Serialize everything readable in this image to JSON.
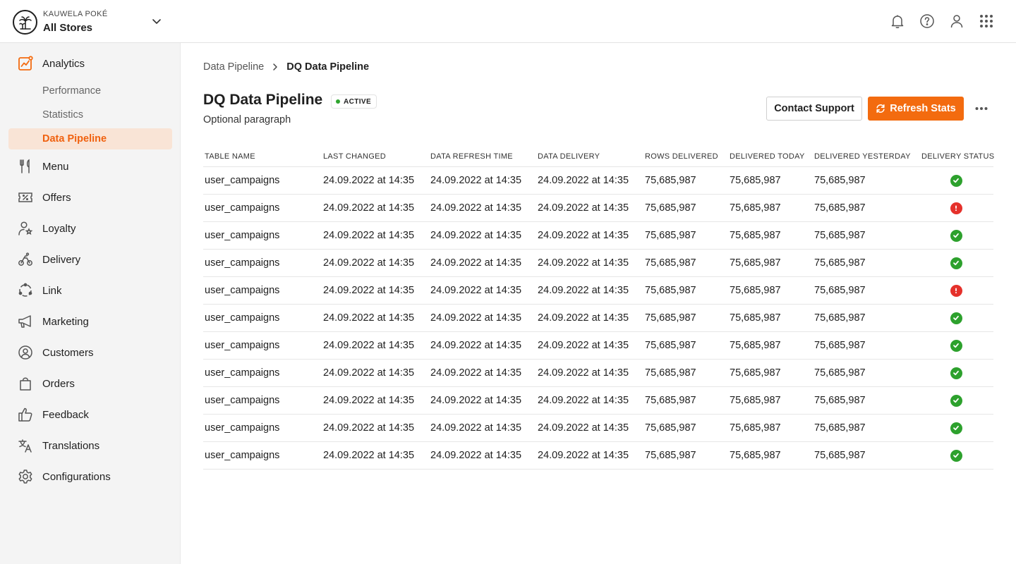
{
  "brand": {
    "company": "KAUWELA POKÉ",
    "store": "All Stores",
    "logo_icon": "palm-tree-icon"
  },
  "topbar": {
    "icons": [
      "bell-icon",
      "help-icon",
      "user-icon",
      "apps-grid-icon"
    ]
  },
  "sidebar": {
    "analytics": {
      "label": "Analytics",
      "sub_items": [
        {
          "label": "Performance"
        },
        {
          "label": "Statistics"
        },
        {
          "label": "Data Pipeline",
          "active": true
        }
      ]
    },
    "items": [
      {
        "label": "Menu",
        "icon": "fork-knife-icon"
      },
      {
        "label": "Offers",
        "icon": "ticket-icon"
      },
      {
        "label": "Loyalty",
        "icon": "user-star-icon"
      },
      {
        "label": "Delivery",
        "icon": "scooter-icon"
      },
      {
        "label": "Link",
        "icon": "link-circle-icon"
      },
      {
        "label": "Marketing",
        "icon": "megaphone-icon"
      },
      {
        "label": "Customers",
        "icon": "customers-icon"
      },
      {
        "label": "Orders",
        "icon": "shopping-bag-icon"
      },
      {
        "label": "Feedback",
        "icon": "thumbs-up-icon"
      },
      {
        "label": "Translations",
        "icon": "translate-icon"
      },
      {
        "label": "Configurations",
        "icon": "gear-icon"
      }
    ]
  },
  "breadcrumb": {
    "parent": "Data Pipeline",
    "current": "DQ Data Pipeline"
  },
  "page": {
    "title": "DQ Data Pipeline",
    "status": "ACTIVE",
    "subtitle": "Optional paragraph"
  },
  "actions": {
    "contact_support": "Contact Support",
    "refresh_stats": "Refresh Stats"
  },
  "colors": {
    "accent": "#f36b0f",
    "ok": "#2da12d",
    "error": "#e5312b"
  },
  "table": {
    "columns": [
      "TABLE NAME",
      "LAST CHANGED",
      "DATA REFRESH TIME",
      "DATA DELIVERY",
      "ROWS DELIVERED",
      "DELIVERED TODAY",
      "DELIVERED YESTERDAY",
      "DELIVERY STATUS"
    ],
    "rows": [
      {
        "table_name": "user_campaigns",
        "last_changed": "24.09.2022 at 14:35",
        "refresh_time": "24.09.2022 at 14:35",
        "delivery": "24.09.2022 at 14:35",
        "rows_delivered": "75,685,987",
        "today": "75,685,987",
        "yesterday": "75,685,987",
        "status": "ok"
      },
      {
        "table_name": "user_campaigns",
        "last_changed": "24.09.2022 at 14:35",
        "refresh_time": "24.09.2022 at 14:35",
        "delivery": "24.09.2022 at 14:35",
        "rows_delivered": "75,685,987",
        "today": "75,685,987",
        "yesterday": "75,685,987",
        "status": "error"
      },
      {
        "table_name": "user_campaigns",
        "last_changed": "24.09.2022 at 14:35",
        "refresh_time": "24.09.2022 at 14:35",
        "delivery": "24.09.2022 at 14:35",
        "rows_delivered": "75,685,987",
        "today": "75,685,987",
        "yesterday": "75,685,987",
        "status": "ok"
      },
      {
        "table_name": "user_campaigns",
        "last_changed": "24.09.2022 at 14:35",
        "refresh_time": "24.09.2022 at 14:35",
        "delivery": "24.09.2022 at 14:35",
        "rows_delivered": "75,685,987",
        "today": "75,685,987",
        "yesterday": "75,685,987",
        "status": "ok"
      },
      {
        "table_name": "user_campaigns",
        "last_changed": "24.09.2022 at 14:35",
        "refresh_time": "24.09.2022 at 14:35",
        "delivery": "24.09.2022 at 14:35",
        "rows_delivered": "75,685,987",
        "today": "75,685,987",
        "yesterday": "75,685,987",
        "status": "error"
      },
      {
        "table_name": "user_campaigns",
        "last_changed": "24.09.2022 at 14:35",
        "refresh_time": "24.09.2022 at 14:35",
        "delivery": "24.09.2022 at 14:35",
        "rows_delivered": "75,685,987",
        "today": "75,685,987",
        "yesterday": "75,685,987",
        "status": "ok"
      },
      {
        "table_name": "user_campaigns",
        "last_changed": "24.09.2022 at 14:35",
        "refresh_time": "24.09.2022 at 14:35",
        "delivery": "24.09.2022 at 14:35",
        "rows_delivered": "75,685,987",
        "today": "75,685,987",
        "yesterday": "75,685,987",
        "status": "ok"
      },
      {
        "table_name": "user_campaigns",
        "last_changed": "24.09.2022 at 14:35",
        "refresh_time": "24.09.2022 at 14:35",
        "delivery": "24.09.2022 at 14:35",
        "rows_delivered": "75,685,987",
        "today": "75,685,987",
        "yesterday": "75,685,987",
        "status": "ok"
      },
      {
        "table_name": "user_campaigns",
        "last_changed": "24.09.2022 at 14:35",
        "refresh_time": "24.09.2022 at 14:35",
        "delivery": "24.09.2022 at 14:35",
        "rows_delivered": "75,685,987",
        "today": "75,685,987",
        "yesterday": "75,685,987",
        "status": "ok"
      },
      {
        "table_name": "user_campaigns",
        "last_changed": "24.09.2022 at 14:35",
        "refresh_time": "24.09.2022 at 14:35",
        "delivery": "24.09.2022 at 14:35",
        "rows_delivered": "75,685,987",
        "today": "75,685,987",
        "yesterday": "75,685,987",
        "status": "ok"
      },
      {
        "table_name": "user_campaigns",
        "last_changed": "24.09.2022 at 14:35",
        "refresh_time": "24.09.2022 at 14:35",
        "delivery": "24.09.2022 at 14:35",
        "rows_delivered": "75,685,987",
        "today": "75,685,987",
        "yesterday": "75,685,987",
        "status": "ok"
      }
    ]
  }
}
